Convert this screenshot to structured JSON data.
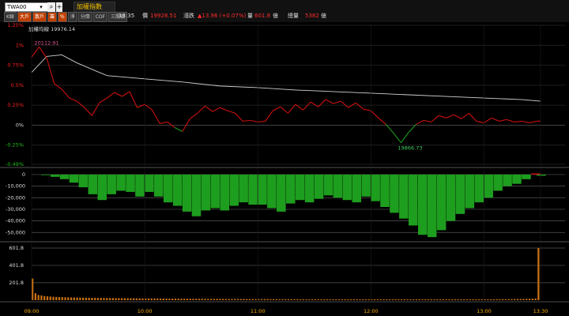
{
  "toolbar": {
    "symbol": "TWA00",
    "index_name": "加權指數",
    "tabs": [
      {
        "label": "K線",
        "active": false
      },
      {
        "label": "大戶",
        "active": true
      },
      {
        "label": "散戶",
        "active": true
      },
      {
        "label": "籌",
        "active": true
      },
      {
        "label": "%",
        "active": true
      },
      {
        "label": "淨",
        "active": false
      },
      {
        "label": "分價",
        "active": false
      },
      {
        "label": "COF",
        "active": false
      },
      {
        "label": "三關價",
        "active": false
      }
    ]
  },
  "quote": {
    "time": "13:35",
    "price_label": "價",
    "price": "19928.51",
    "change_label": "漲跌",
    "change": "▲13.96 (+0.07%)",
    "volume_label": "量",
    "volume": "601.8",
    "volume_unit": "億",
    "total_label": "總量",
    "total": "5382",
    "total_unit": "億"
  },
  "chart_data": [
    {
      "type": "line",
      "title": "加權均線 19976.14",
      "x_ticks": [
        "09:00",
        "10:00",
        "11:00",
        "12:00",
        "13:00",
        "13:30"
      ],
      "y_ticks": [
        "1.25%",
        "1%",
        "0.75%",
        "0.5%",
        "0.25%",
        "0%",
        "-0.25%",
        "-0.49%"
      ],
      "ylim_pct": [
        -0.49,
        1.25
      ],
      "annotations": [
        "20112.91",
        "19866.73"
      ],
      "colors": {
        "up": "#d01010",
        "down": "#1e9e1e",
        "avg": "#d0d0d0"
      },
      "series": [
        {
          "kind": "price_pct",
          "x": [
            0,
            4,
            8,
            12,
            16,
            20,
            24,
            28,
            32,
            36,
            40,
            44,
            48,
            52,
            56,
            60,
            64,
            68,
            72,
            76,
            80,
            84,
            88,
            92,
            96,
            100,
            104,
            108,
            112,
            116,
            120,
            124,
            128,
            132,
            136,
            140,
            144,
            148,
            152,
            156,
            160,
            164,
            168,
            172,
            176,
            180,
            184,
            188,
            192,
            196,
            200,
            204,
            208,
            212,
            216,
            220,
            224,
            228,
            232,
            236,
            240,
            244,
            248,
            252,
            256,
            260,
            264,
            268,
            270
          ],
          "y": [
            0.85,
            0.98,
            0.84,
            0.52,
            0.45,
            0.34,
            0.3,
            0.22,
            0.12,
            0.28,
            0.34,
            0.41,
            0.36,
            0.42,
            0.22,
            0.26,
            0.19,
            0.02,
            0.04,
            -0.03,
            -0.08,
            0.08,
            0.15,
            0.24,
            0.17,
            0.22,
            0.18,
            0.15,
            0.05,
            0.06,
            0.04,
            0.05,
            0.18,
            0.23,
            0.15,
            0.26,
            0.19,
            0.29,
            0.23,
            0.32,
            0.27,
            0.3,
            0.22,
            0.28,
            0.2,
            0.18,
            0.09,
            0.01,
            -0.1,
            -0.22,
            -0.09,
            0.01,
            0.06,
            0.04,
            0.12,
            0.09,
            0.13,
            0.08,
            0.15,
            0.05,
            0.03,
            0.09,
            0.05,
            0.07,
            0.04,
            0.05,
            0.03,
            0.05,
            0.05
          ]
        },
        {
          "kind": "avg_pct",
          "x": [
            0,
            8,
            16,
            24,
            40,
            60,
            80,
            100,
            120,
            140,
            160,
            180,
            200,
            220,
            240,
            260,
            270
          ],
          "y": [
            0.66,
            0.86,
            0.88,
            0.78,
            0.62,
            0.58,
            0.54,
            0.49,
            0.47,
            0.44,
            0.42,
            0.4,
            0.38,
            0.36,
            0.34,
            0.32,
            0.3
          ]
        }
      ]
    },
    {
      "type": "area",
      "title": "",
      "y_ticks": [
        "0",
        "-10,000",
        "-20,000",
        "-30,000",
        "-40,000",
        "-50,000"
      ],
      "ylim": [
        -58000,
        2000
      ],
      "x": [
        0,
        5,
        10,
        15,
        20,
        25,
        30,
        35,
        40,
        45,
        50,
        55,
        60,
        65,
        70,
        75,
        80,
        85,
        90,
        95,
        100,
        105,
        110,
        115,
        120,
        125,
        130,
        135,
        140,
        145,
        150,
        155,
        160,
        165,
        170,
        175,
        180,
        185,
        190,
        195,
        200,
        205,
        210,
        215,
        220,
        225,
        230,
        235,
        240,
        245,
        250,
        255,
        260,
        265,
        268
      ],
      "values": [
        0,
        -500,
        -2000,
        -4000,
        -7000,
        -11000,
        -17000,
        -22000,
        -17000,
        -14000,
        -15000,
        -19000,
        -15000,
        -19000,
        -24000,
        -27000,
        -32000,
        -36000,
        -31000,
        -29000,
        -31000,
        -27000,
        -24000,
        -26000,
        -26000,
        -29000,
        -32000,
        -25000,
        -22000,
        -24000,
        -21000,
        -18000,
        -20000,
        -22000,
        -24000,
        -19000,
        -23000,
        -28000,
        -33000,
        -38000,
        -44000,
        -52000,
        -54000,
        -48000,
        -40000,
        -34000,
        -29000,
        -24000,
        -20000,
        -14000,
        -10000,
        -8000,
        -4000,
        1000,
        -1000
      ]
    },
    {
      "type": "bar",
      "title": "",
      "y_ticks": [
        "601.8",
        "401.8",
        "201.8"
      ],
      "ylim": [
        0,
        620
      ],
      "series": [
        {
          "values": [
            250,
            80,
            60,
            55,
            48,
            45,
            42,
            40,
            38,
            36,
            35,
            34,
            33,
            32,
            31,
            30,
            30,
            29,
            28,
            28,
            27,
            27,
            26,
            26,
            25,
            25,
            24,
            24,
            24,
            23,
            23,
            23,
            22,
            22,
            22,
            21,
            21,
            21,
            20,
            20,
            20,
            20,
            19,
            19,
            19,
            19,
            18,
            18,
            18,
            18,
            17,
            17,
            17,
            17,
            16,
            16,
            16,
            16,
            16,
            15,
            15,
            15,
            15,
            15,
            15,
            14,
            14,
            14,
            14,
            14,
            14,
            14,
            13,
            13,
            13,
            13,
            13,
            13,
            13,
            13,
            12,
            12,
            12,
            12,
            12,
            12,
            12,
            12,
            12,
            12,
            11,
            11,
            11,
            11,
            11,
            11,
            11,
            11,
            11,
            11,
            11,
            11,
            11,
            11,
            11,
            11,
            11,
            11,
            11,
            11,
            11,
            11,
            11,
            11,
            11,
            11,
            11,
            11,
            11,
            11,
            11,
            11,
            11,
            11,
            11,
            11,
            11,
            11,
            11,
            11,
            11,
            11,
            11,
            11,
            11,
            11,
            11,
            11,
            11,
            11,
            11,
            11,
            11,
            11,
            11,
            11,
            11,
            11,
            11,
            11,
            11,
            11,
            11,
            11,
            11,
            11,
            12,
            12,
            12,
            12,
            12,
            13,
            13,
            14,
            14,
            15,
            16,
            17,
            18,
            20,
            601.8
          ]
        }
      ]
    }
  ]
}
